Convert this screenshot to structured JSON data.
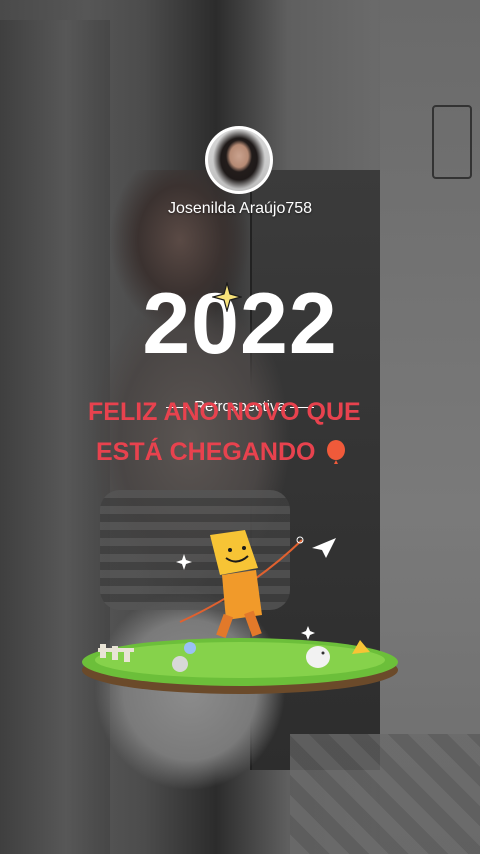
{
  "profile": {
    "username": "Josenilda Araújo758"
  },
  "story": {
    "year": "2022",
    "subtitle": "Retrospectiva",
    "message_line1": "FELIZ ANO NOVO QUE",
    "message_line2": "ESTÁ CHEGANDO"
  },
  "colors": {
    "message": "#e8424e",
    "accent_yellow": "#f7c435"
  },
  "icons": {
    "balloon": "balloon-icon",
    "sparkle": "sparkle-icon",
    "paper_plane": "paper-plane-icon"
  }
}
